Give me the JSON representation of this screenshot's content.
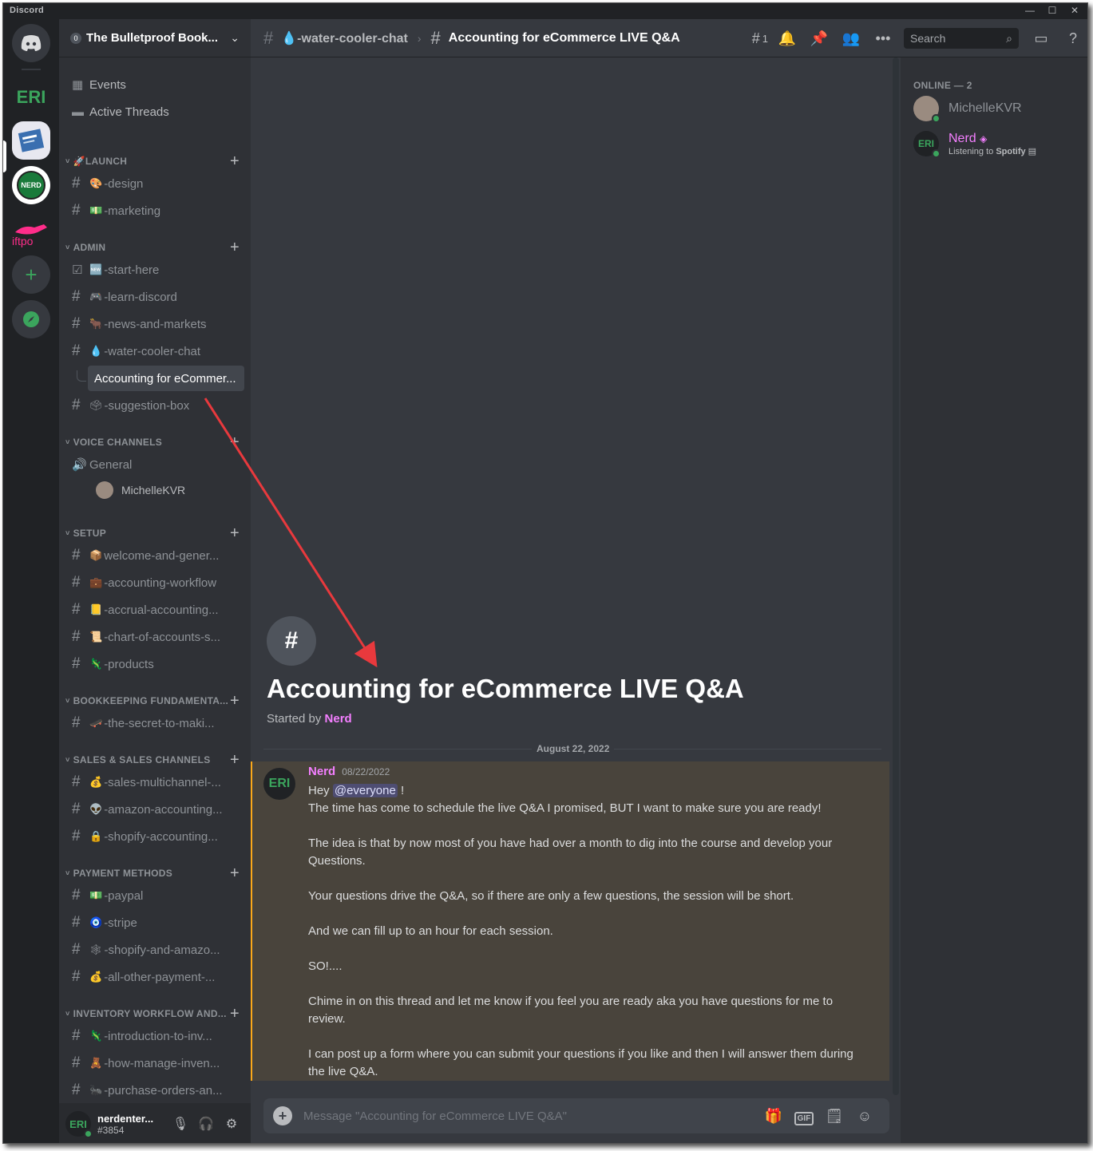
{
  "app": {
    "title": "Discord"
  },
  "window_controls": {
    "minimize": "—",
    "maximize": "☐",
    "close": "✕"
  },
  "servers": {
    "nerd_label": "ERI",
    "nerd_badge": "NERD",
    "swift_label": "iftpo"
  },
  "guild": {
    "name": "The Bulletproof Book...",
    "badge": "0"
  },
  "sidebar": {
    "top_items": [
      {
        "label": "Events",
        "icon": "calendar-icon"
      },
      {
        "label": "Active Threads",
        "icon": "threads-icon"
      }
    ],
    "categories": [
      {
        "name": "LAUNCH",
        "channels": [
          {
            "emoji": "🎨",
            "label": "-design"
          },
          {
            "emoji": "💵",
            "label": "-marketing"
          }
        ]
      },
      {
        "name": "ADMIN",
        "channels": [
          {
            "emoji": "🆕",
            "label": "-start-here"
          },
          {
            "emoji": "🎮",
            "label": "-learn-discord"
          },
          {
            "emoji": "🐂",
            "label": "-news-and-markets"
          },
          {
            "emoji": "💧",
            "label": "-water-cooler-chat"
          },
          {
            "emoji": "",
            "label": "Accounting for eCommer..."
          },
          {
            "emoji": "🗳",
            "label": "-suggestion-box"
          }
        ]
      },
      {
        "name": "VOICE CHANNELS",
        "channels": [
          {
            "emoji": "",
            "label": "General"
          }
        ],
        "voice_user": "MichelleKVR"
      },
      {
        "name": "SETUP",
        "channels": [
          {
            "emoji": "📦",
            "label": "welcome-and-gener..."
          },
          {
            "emoji": "💼",
            "label": "-accounting-workflow"
          },
          {
            "emoji": "📒",
            "label": "-accrual-accounting..."
          },
          {
            "emoji": "📜",
            "label": "-chart-of-accounts-s..."
          },
          {
            "emoji": "🦎",
            "label": "-products"
          }
        ]
      },
      {
        "name": "BOOKKEEPING FUNDAMENTA...",
        "channels": [
          {
            "emoji": "🛹",
            "label": "-the-secret-to-maki..."
          }
        ]
      },
      {
        "name": "SALES & SALES CHANNELS",
        "channels": [
          {
            "emoji": "💰",
            "label": "-sales-multichannel-..."
          },
          {
            "emoji": "👽",
            "label": "-amazon-accounting..."
          },
          {
            "emoji": "🔒",
            "label": "-shopify-accounting..."
          }
        ]
      },
      {
        "name": "PAYMENT METHODS",
        "channels": [
          {
            "emoji": "💵",
            "label": "-paypal"
          },
          {
            "emoji": "🧿",
            "label": "-stripe"
          },
          {
            "emoji": "🕸",
            "label": "-shopify-and-amazo..."
          },
          {
            "emoji": "💰",
            "label": "-all-other-payment-..."
          }
        ]
      },
      {
        "name": "INVENTORY WORKFLOW AND...",
        "channels": [
          {
            "emoji": "🦎",
            "label": "-introduction-to-inv..."
          },
          {
            "emoji": "🧸",
            "label": "-how-manage-inven..."
          },
          {
            "emoji": "🐜",
            "label": "-purchase-orders-an..."
          }
        ]
      }
    ]
  },
  "user_panel": {
    "avatar": "ERI",
    "name": "nerdenter...",
    "tag": "#3854"
  },
  "topbar": {
    "parent_channel": "💧-water-cooler-chat",
    "thread_title": "Accounting for eCommerce LIVE Q&A",
    "thread_count": "1",
    "search_placeholder": "Search"
  },
  "thread": {
    "title": "Accounting for eCommerce LIVE Q&A",
    "started_by_prefix": "Started by",
    "started_by": "Nerd",
    "date_divider": "August 22, 2022"
  },
  "message": {
    "author": "Nerd",
    "timestamp": "08/22/2022",
    "avatar": "ERI",
    "greeting": "Hey",
    "mention": "@everyone",
    "greeting_end": "!",
    "paragraphs": [
      "The time has come to schedule the live Q&A I promised, BUT I want to make sure you are ready!",
      "The idea is that by now most of you have had over a month to dig into the course and develop your Questions.",
      "Your questions drive the Q&A, so if there are only a few questions, the session will be short.",
      "And we can fill up to an hour for each session.",
      "SO!....",
      "Chime in on this thread and let me know if you feel you are ready aka you have questions for me to review.",
      "I can post up a form where you can submit your questions if you like and then I will answer them during the live Q&A."
    ]
  },
  "composer": {
    "placeholder": "Message \"Accounting for eCommerce LIVE Q&A\"",
    "gif_label": "GIF"
  },
  "members": {
    "category": "ONLINE — 2",
    "list": [
      {
        "name": "MichelleKVR",
        "activity": ""
      },
      {
        "name": "Nerd",
        "activity_prefix": "Listening to",
        "activity_app": "Spotify"
      }
    ]
  },
  "colors": {
    "accent_pink": "#f47fff",
    "online": "#3ba55d",
    "highlight_border": "#faa81a",
    "arrow": "#e8393d"
  }
}
